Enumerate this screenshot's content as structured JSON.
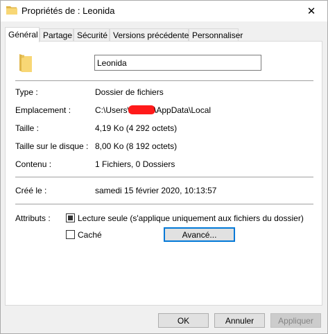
{
  "window": {
    "title": "Propriétés de : Leonida",
    "close_glyph": "✕"
  },
  "tabs": [
    {
      "label": "Général",
      "active": true
    },
    {
      "label": "Partage",
      "active": false
    },
    {
      "label": "Sécurité",
      "active": false
    },
    {
      "label": "Versions précédentes",
      "active": false
    },
    {
      "label": "Personnaliser",
      "active": false
    }
  ],
  "general": {
    "name_value": "Leonida",
    "type_label": "Type :",
    "type_value": "Dossier de fichiers",
    "location_label": "Emplacement :",
    "location_prefix": "C:\\Users\\",
    "location_suffix": "\\AppData\\Local",
    "size_label": "Taille :",
    "size_value": "4,19 Ko (4 292 octets)",
    "disk_size_label": "Taille sur le disque :",
    "disk_size_value": "8,00 Ko (8 192 octets)",
    "contents_label": "Contenu :",
    "contents_value": "1 Fichiers, 0 Dossiers",
    "created_label": "Créé le :",
    "created_value": "samedi 15 février 2020, 10:13:57",
    "attributes_label": "Attributs :",
    "readonly_label": "Lecture seule (s'applique uniquement aux fichiers du dossier)",
    "readonly_checked": true,
    "hidden_label": "Caché",
    "hidden_checked": false,
    "advanced_button": "Avancé..."
  },
  "footer": {
    "ok": "OK",
    "cancel": "Annuler",
    "apply": "Appliquer"
  },
  "colors": {
    "folder_yellow": "#f8d775",
    "folder_dark": "#e0b64a",
    "redaction": "#ff1a1a",
    "focus_blue": "#0078d7"
  },
  "icons": {
    "title": "folder-icon",
    "big": "folder-icon"
  }
}
